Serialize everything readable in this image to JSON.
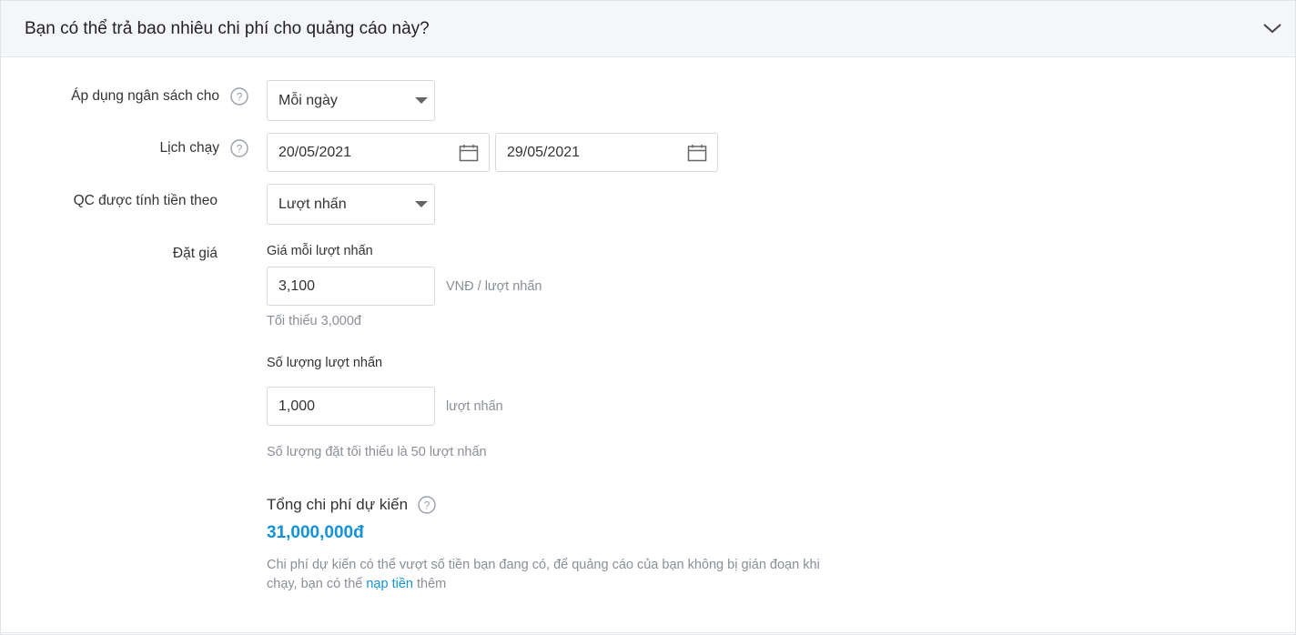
{
  "header": {
    "title": "Bạn có thể trả bao nhiêu chi phí cho quảng cáo này?",
    "toggle_icon": "chevron-down-icon"
  },
  "budget": {
    "label": "Áp dụng ngân sách cho",
    "value": "Mỗi ngày"
  },
  "schedule": {
    "label": "Lịch chạy",
    "start_date": "20/05/2021",
    "end_date": "29/05/2021"
  },
  "billing": {
    "label": "QC được tính tiền theo",
    "value": "Lượt nhấn"
  },
  "pricing": {
    "label": "Đặt giá",
    "price_label": "Giá mỗi lượt nhấn",
    "price_value": "3,100",
    "price_unit": "VNĐ / lượt nhấn",
    "price_hint": "Tối thiểu 3,000đ",
    "qty_label": "Số lượng lượt nhấn",
    "qty_value": "1,000",
    "qty_unit": "lượt nhấn",
    "qty_hint": "Số lượng đặt tối thiểu là 50 lượt nhấn"
  },
  "total": {
    "label": "Tổng chi phí dự kiến",
    "value": "31,000,000đ",
    "note_before": "Chi phí dự kiến có thể vượt số tiền bạn đang có, để quảng cáo của bạn không bị gián đoạn khi chạy, bạn có thể ",
    "note_link": "nạp tiền",
    "note_after": " thêm"
  },
  "colors": {
    "accent": "#1592d6",
    "header_bg": "#f4f6fa",
    "muted_text": "#8a8f96"
  }
}
